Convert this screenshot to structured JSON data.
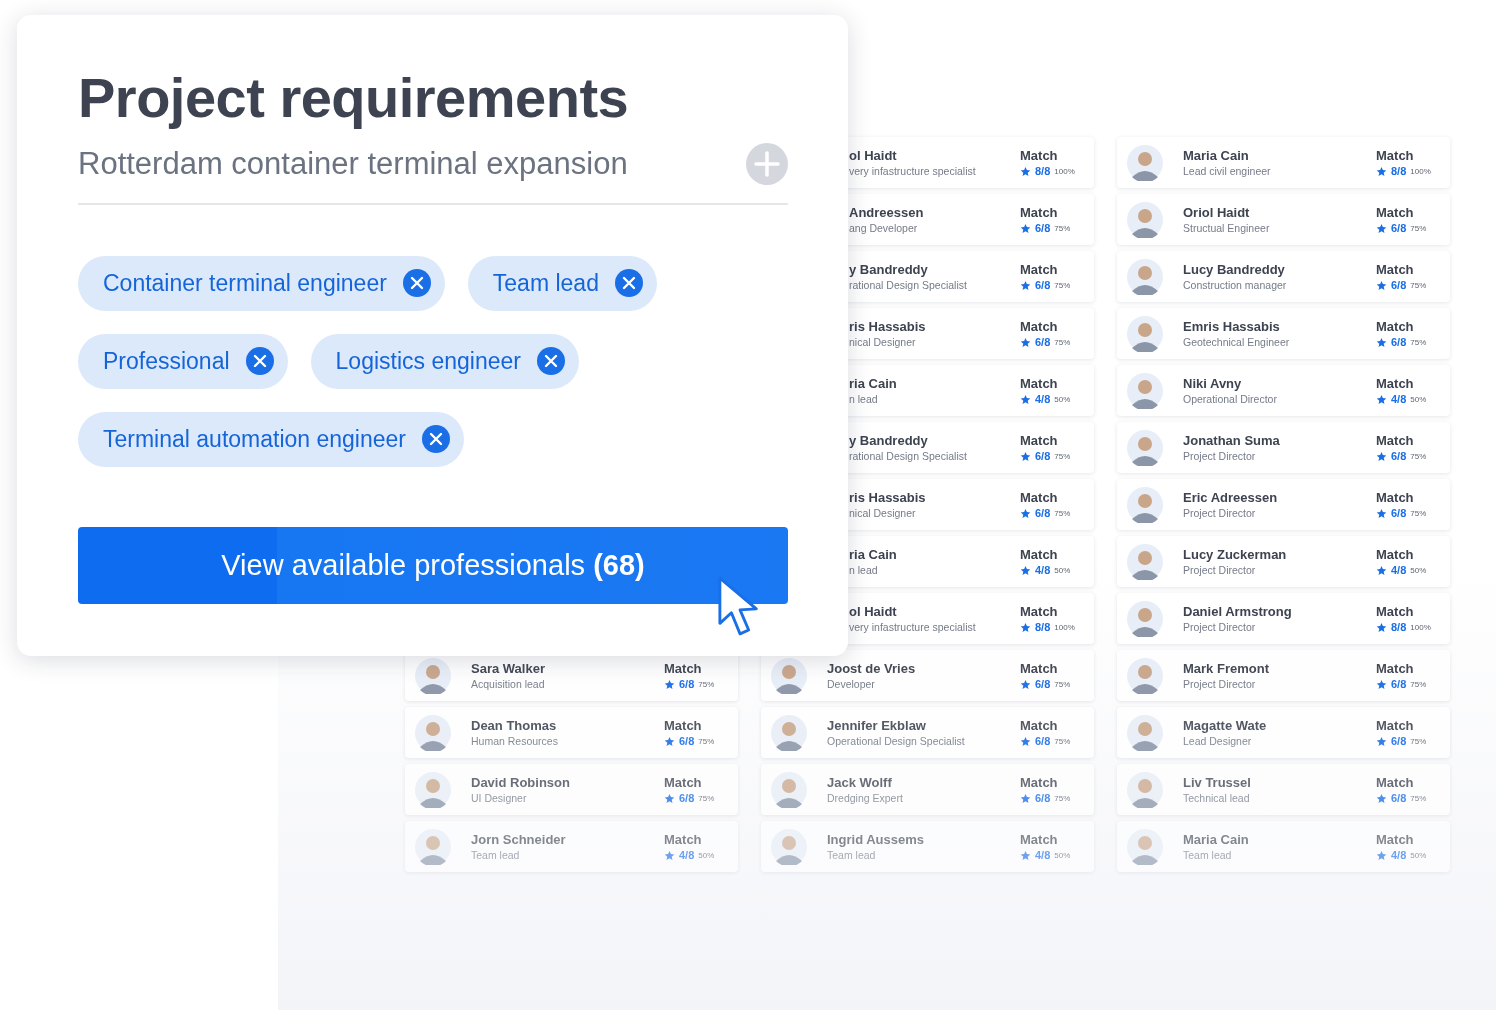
{
  "requirements": {
    "title": "Project requirements",
    "subtitle": "Rotterdam container terminal expansion",
    "tags": [
      {
        "label": "Container terminal engineer"
      },
      {
        "label": "Team lead"
      },
      {
        "label": "Professional"
      },
      {
        "label": "Logistics engineer"
      },
      {
        "label": "Terminal automation engineer"
      }
    ],
    "button": "View available professionals **(68)**"
  },
  "columns": [
    {
      "cards": [
        {
          "kind": "full",
          "name": "Sara Walker",
          "role": "Acquisition lead",
          "match": "Match",
          "score": "6/8",
          "percent": "75%"
        },
        {
          "kind": "full",
          "name": "Dean Thomas",
          "role": "Human Resources",
          "match": "Match",
          "score": "6/8",
          "percent": "75%"
        },
        {
          "kind": "full",
          "name": "David Robinson",
          "role": "UI Designer",
          "match": "Match",
          "score": "6/8",
          "percent": "75%"
        },
        {
          "kind": "full",
          "name": "Jorn Schneider",
          "role": "Team lead",
          "match": "Match",
          "score": "4/8",
          "percent": "50%"
        }
      ]
    },
    {
      "cards": [
        {
          "kind": "partial",
          "name": "ol Haidt",
          "role": "very infastructure specialist",
          "match": "Match",
          "score": "8/8",
          "percent": "100%"
        },
        {
          "kind": "partial",
          "name": "Andreessen",
          "role": "ang Developer",
          "match": "Match",
          "score": "6/8",
          "percent": "75%"
        },
        {
          "kind": "partial",
          "name": "y Bandreddy",
          "role": "rational Design Specialist",
          "match": "Match",
          "score": "6/8",
          "percent": "75%"
        },
        {
          "kind": "partial",
          "name": "ris Hassabis",
          "role": "nical Designer",
          "match": "Match",
          "score": "6/8",
          "percent": "75%"
        },
        {
          "kind": "partial",
          "name": "ria Cain",
          "role": "n lead",
          "match": "Match",
          "score": "4/8",
          "percent": "50%"
        },
        {
          "kind": "partial",
          "name": "y Bandreddy",
          "role": "rational Design Specialist",
          "match": "Match",
          "score": "6/8",
          "percent": "75%"
        },
        {
          "kind": "partial",
          "name": "ris Hassabis",
          "role": "nical Designer",
          "match": "Match",
          "score": "6/8",
          "percent": "75%"
        },
        {
          "kind": "partial",
          "name": "ria Cain",
          "role": "n lead",
          "match": "Match",
          "score": "4/8",
          "percent": "50%"
        },
        {
          "kind": "partial",
          "name": "ol Haidt",
          "role": "very infastructure specialist",
          "match": "Match",
          "score": "8/8",
          "percent": "100%"
        },
        {
          "kind": "full",
          "name": "Joost de Vries",
          "role": "Developer",
          "match": "Match",
          "score": "6/8",
          "percent": "75%"
        },
        {
          "kind": "full",
          "name": "Jennifer Ekblaw",
          "role": "Operational Design Specialist",
          "match": "Match",
          "score": "6/8",
          "percent": "75%"
        },
        {
          "kind": "full",
          "name": "Jack Wolff",
          "role": "Dredging Expert",
          "match": "Match",
          "score": "6/8",
          "percent": "75%"
        },
        {
          "kind": "full",
          "name": "Ingrid Aussems",
          "role": "Team lead",
          "match": "Match",
          "score": "4/8",
          "percent": "50%"
        }
      ]
    },
    {
      "cards": [
        {
          "kind": "full",
          "name": "Maria Cain",
          "role": "Lead civil engineer",
          "match": "Match",
          "score": "8/8",
          "percent": "100%"
        },
        {
          "kind": "full",
          "name": "Oriol Haidt",
          "role": "Structual Engineer",
          "match": "Match",
          "score": "6/8",
          "percent": "75%"
        },
        {
          "kind": "full",
          "name": "Lucy Bandreddy",
          "role": "Construction manager",
          "match": "Match",
          "score": "6/8",
          "percent": "75%"
        },
        {
          "kind": "full",
          "name": "Emris Hassabis",
          "role": "Geotechnical Engineer",
          "match": "Match",
          "score": "6/8",
          "percent": "75%"
        },
        {
          "kind": "full",
          "name": "Niki Avny",
          "role": "Operational Director",
          "match": "Match",
          "score": "4/8",
          "percent": "50%"
        },
        {
          "kind": "full",
          "name": "Jonathan Suma",
          "role": "Project Director",
          "match": "Match",
          "score": "6/8",
          "percent": "75%"
        },
        {
          "kind": "full",
          "name": "Eric Adreessen",
          "role": "Project Director",
          "match": "Match",
          "score": "6/8",
          "percent": "75%"
        },
        {
          "kind": "full",
          "name": "Lucy Zuckerman",
          "role": "Project Director",
          "match": "Match",
          "score": "4/8",
          "percent": "50%"
        },
        {
          "kind": "full",
          "name": "Daniel Armstrong",
          "role": "Project Director",
          "match": "Match",
          "score": "8/8",
          "percent": "100%"
        },
        {
          "kind": "full",
          "name": "Mark Fremont",
          "role": "Project Director",
          "match": "Match",
          "score": "6/8",
          "percent": "75%"
        },
        {
          "kind": "full",
          "name": "Magatte Wate",
          "role": "Lead Designer",
          "match": "Match",
          "score": "6/8",
          "percent": "75%"
        },
        {
          "kind": "full",
          "name": "Liv Trussel",
          "role": "Technical lead",
          "match": "Match",
          "score": "6/8",
          "percent": "75%"
        },
        {
          "kind": "full",
          "name": "Maria Cain",
          "role": "Team lead",
          "match": "Match",
          "score": "4/8",
          "percent": "50%"
        }
      ]
    }
  ]
}
